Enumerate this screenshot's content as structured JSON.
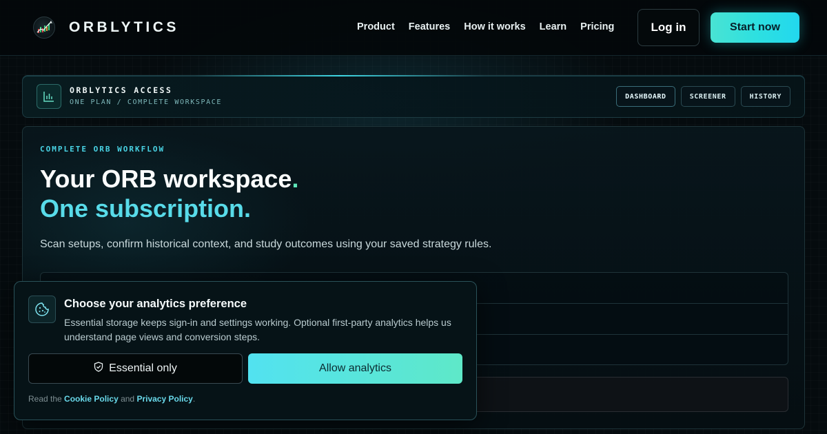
{
  "header": {
    "brand": "ORBLYTICS",
    "logo_icon": "orb-chart-logo-icon",
    "nav": [
      "Product",
      "Features",
      "How it works",
      "Learn",
      "Pricing"
    ],
    "login_label": "Log in",
    "start_label": "Start now"
  },
  "access_bar": {
    "icon": "bar-chart-icon",
    "title": "ORBLYTICS ACCESS",
    "subtitle": "ONE PLAN / COMPLETE WORKSPACE",
    "tabs": [
      "DASHBOARD",
      "SCREENER",
      "HISTORY"
    ]
  },
  "main": {
    "eyebrow": "COMPLETE ORB WORKFLOW",
    "headline_line1": "Your ORB workspace",
    "headline_dot": ".",
    "headline_line2": "One subscription.",
    "lede": "Scan setups, confirm historical context, and study outcomes using your saved strategy rules."
  },
  "cookie": {
    "icon": "cookie-icon",
    "title": "Choose your analytics preference",
    "text": "Essential storage keeps sign-in and settings working. Optional first-party analytics helps us understand page views and conversion steps.",
    "essential_icon": "shield-check-icon",
    "essential_label": "Essential only",
    "allow_label": "Allow analytics",
    "foot_prefix": "Read the ",
    "cookie_policy": "Cookie Policy",
    "foot_and": " and ",
    "privacy_policy": "Privacy Policy",
    "foot_suffix": "."
  },
  "colors": {
    "accent_cyan": "#58dbe9",
    "accent_mint": "#5ee6b9",
    "background": "#050b0e"
  }
}
